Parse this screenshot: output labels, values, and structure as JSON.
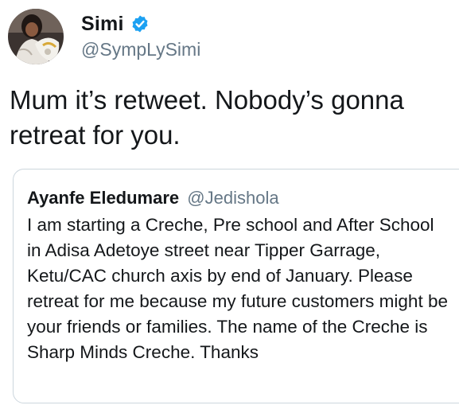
{
  "tweet": {
    "author": {
      "display_name": "Simi",
      "handle": "@SympLySimi",
      "verified": true,
      "avatar_icon": "profile-photo"
    },
    "text": "Mum it’s retweet. Nobody’s gonna retreat for you.",
    "quoted_tweet": {
      "author": {
        "display_name": "Ayanfe Eledumare",
        "handle": "@Jedishola"
      },
      "text": "I am starting a Creche, Pre school and After School in Adisa Adetoye street near Tipper Garrage, Ketu/CAC church axis by end of January. Please retreat for me because my future customers might be your friends or families. The name of the Creche is Sharp Minds Creche. Thanks"
    }
  },
  "colors": {
    "verified_badge": "#1da1f2",
    "secondary_text": "#657786",
    "primary_text": "#14171a",
    "border": "#ccd6dd"
  }
}
